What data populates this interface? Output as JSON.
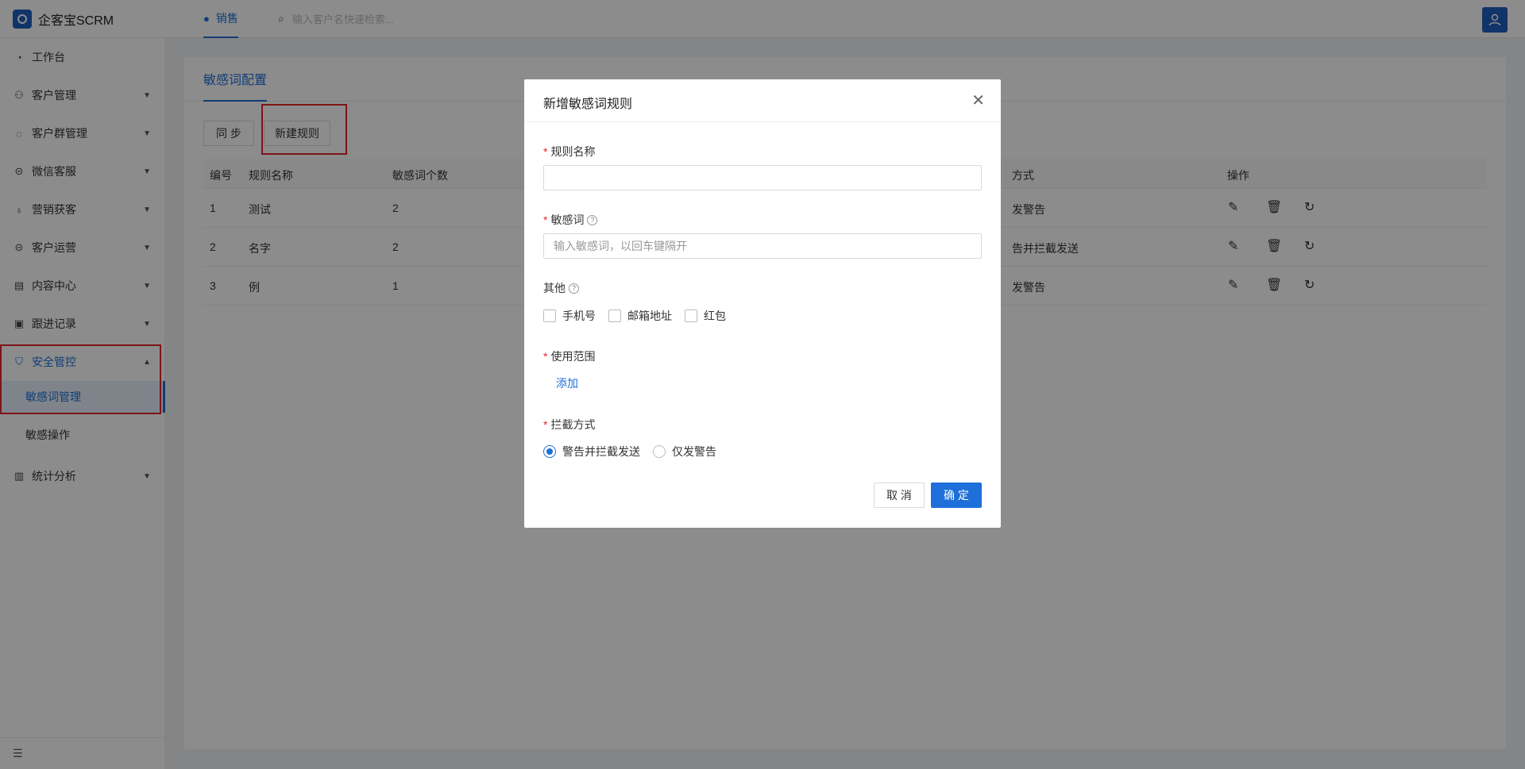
{
  "app": {
    "logo_text": "企客宝SCRM"
  },
  "topbar": {
    "tab_label": "销售",
    "search_placeholder": "输入客户名快速检索..."
  },
  "sidebar": {
    "items": [
      {
        "label": "工作台",
        "icon": "dashboard-icon"
      },
      {
        "label": "客户管理",
        "icon": "customer-icon"
      },
      {
        "label": "客户群管理",
        "icon": "group-chat-icon"
      },
      {
        "label": "微信客服",
        "icon": "wechat-service-icon"
      },
      {
        "label": "营销获客",
        "icon": "marketing-icon"
      },
      {
        "label": "客户运营",
        "icon": "operation-icon"
      },
      {
        "label": "内容中心",
        "icon": "content-icon"
      },
      {
        "label": "跟进记录",
        "icon": "record-icon"
      },
      {
        "label": "安全管控",
        "icon": "shield-icon"
      },
      {
        "label": "统计分析",
        "icon": "chart-icon"
      }
    ],
    "submenu": [
      {
        "label": "敏感词管理"
      },
      {
        "label": "敏感操作"
      }
    ]
  },
  "main": {
    "tab": "敏感词配置",
    "buttons": {
      "sync": "同 步",
      "new_rule": "新建规则"
    },
    "table": {
      "headers": [
        "编号",
        "规则名称",
        "敏感词个数",
        "方式",
        "操作"
      ],
      "rows": [
        {
          "id": "1",
          "name": "测试",
          "count": "2",
          "method": "发警告"
        },
        {
          "id": "2",
          "name": "名字",
          "count": "2",
          "method": "告并拦截发送"
        },
        {
          "id": "3",
          "name": "例",
          "count": "1",
          "method": "发警告"
        }
      ]
    }
  },
  "modal": {
    "title": "新增敏感词规则",
    "fields": {
      "rule_name_label": "规则名称",
      "rule_name_value": "",
      "sensitive_label": "敏感词",
      "sensitive_placeholder": "输入敏感词，以回车键隔开",
      "other_label": "其他",
      "other_options": [
        "手机号",
        "邮箱地址",
        "红包"
      ],
      "scope_label": "使用范围",
      "scope_add": "添加",
      "intercept_label": "拦截方式",
      "intercept_options": [
        "警告并拦截发送",
        "仅发警告"
      ],
      "intercept_selected": "警告并拦截发送"
    },
    "buttons": {
      "cancel": "取 消",
      "ok": "确 定"
    }
  },
  "colors": {
    "accent": "#1e6fd9",
    "highlight": "#e4252b",
    "brand": "#1e5fbf"
  }
}
